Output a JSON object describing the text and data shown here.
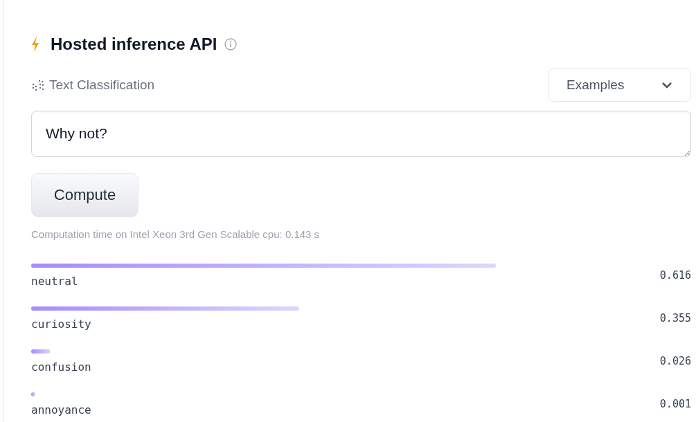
{
  "header": {
    "title": "Hosted inference API"
  },
  "task": {
    "label": "Text Classification"
  },
  "examples": {
    "label": "Examples"
  },
  "input": {
    "value": "Why not?"
  },
  "compute_button": "Compute",
  "timing": "Computation time on Intel Xeon 3rd Gen Scalable cpu: 0.143 s",
  "results": [
    {
      "label": "neutral",
      "score": "0.616"
    },
    {
      "label": "curiosity",
      "score": "0.355"
    },
    {
      "label": "confusion",
      "score": "0.026"
    },
    {
      "label": "annoyance",
      "score": "0.001"
    }
  ]
}
